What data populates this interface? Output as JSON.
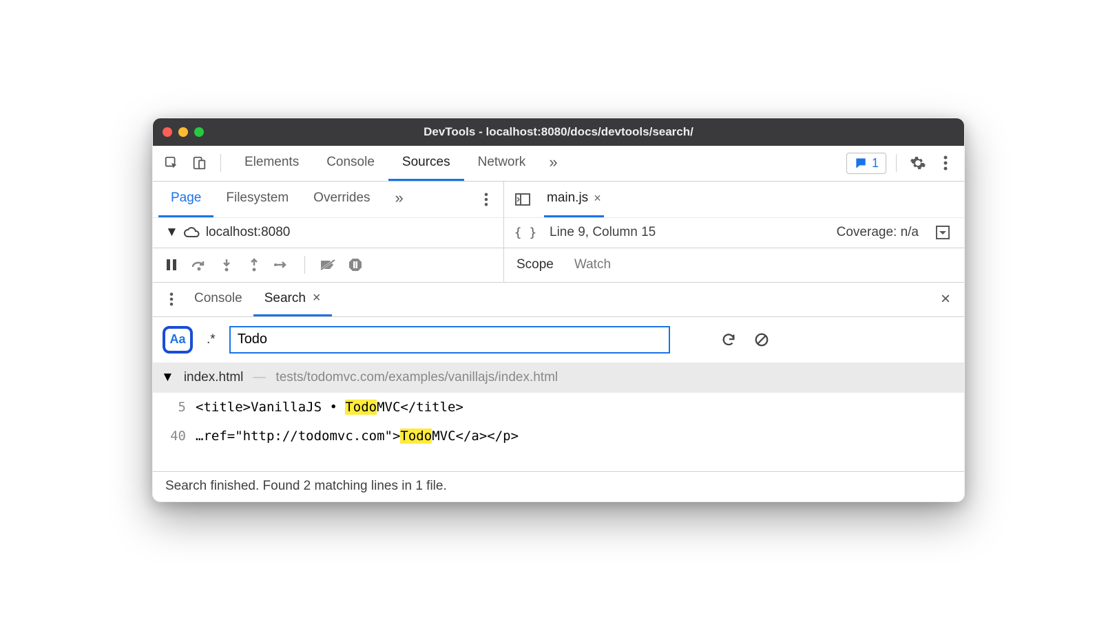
{
  "window": {
    "title": "DevTools - localhost:8080/docs/devtools/search/"
  },
  "mainTabs": {
    "elements": "Elements",
    "console": "Console",
    "sources": "Sources",
    "network": "Network"
  },
  "feedback": {
    "count": "1"
  },
  "navigator": {
    "page": "Page",
    "filesystem": "Filesystem",
    "overrides": "Overrides"
  },
  "tree": {
    "host": "localhost:8080"
  },
  "editor": {
    "filename": "main.js",
    "cursor": "Line 9, Column 15",
    "coverage": "Coverage: n/a"
  },
  "debugTabs": {
    "scope": "Scope",
    "watch": "Watch"
  },
  "drawer": {
    "console": "Console",
    "search": "Search"
  },
  "search": {
    "caseLabel": "Aa",
    "regexLabel": ".*",
    "query": "Todo"
  },
  "results": {
    "file": "index.html",
    "path": "tests/todomvc.com/examples/vanillajs/index.html",
    "lines": [
      {
        "n": "5",
        "pre": "<title>VanillaJS • ",
        "match": "Todo",
        "post": "MVC</title>"
      },
      {
        "n": "40",
        "pre": "…ref=\"http://todomvc.com\">",
        "match": "Todo",
        "post": "MVC</a></p>"
      }
    ]
  },
  "status": "Search finished.  Found 2 matching lines in 1 file."
}
